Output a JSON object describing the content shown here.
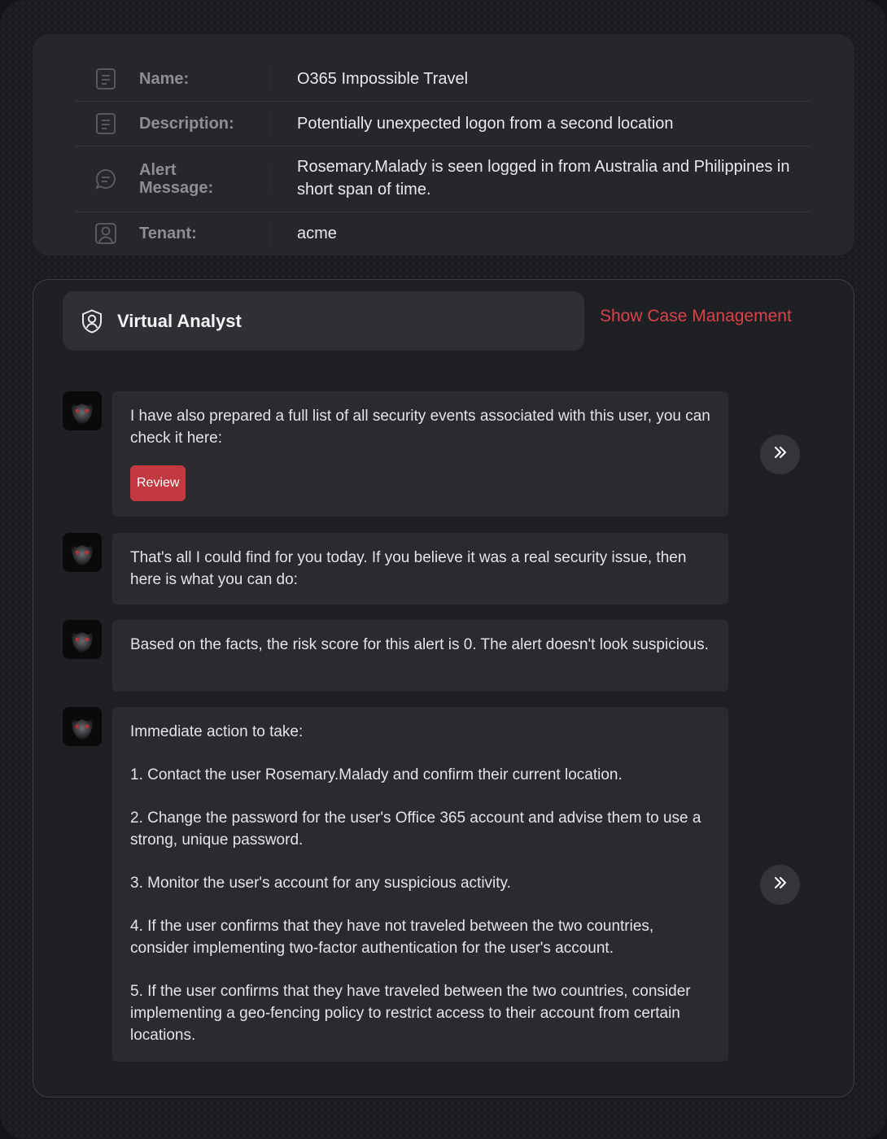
{
  "info": {
    "name_label": "Name:",
    "name_value": "O365 Impossible Travel",
    "description_label": "Description:",
    "description_value": "Potentially unexpected logon from a second location",
    "alert_label": "Alert Message:",
    "alert_value": "Rosemary.Malady is seen logged in from Australia and Philippines in short span of time.",
    "tenant_label": "Tenant:",
    "tenant_value": "acme",
    "icons": [
      "document-icon",
      "document-icon",
      "chat-icon",
      "user-icon"
    ]
  },
  "panel": {
    "title": "Virtual Analyst",
    "case_link": "Show Case Management",
    "accent_color": "#d7434b"
  },
  "messages": [
    {
      "text": "I have also prepared a full list of all security events associated with this user, you can check it here:",
      "button": "Review"
    },
    {
      "text": "That's all I could find for you today. If you believe it was a real security issue, then here is what you can do:"
    },
    {
      "text": "Based on the facts, the risk score for this alert is 0. The alert doesn't look suspicious."
    },
    {
      "intro": "Immediate action to take:",
      "steps": [
        "1. Contact the user Rosemary.Malady and confirm their current location.",
        "2. Change the password for the user's Office 365 account and advise them to use a strong, unique password.",
        "3. Monitor the user's account for any suspicious activity.",
        "4. If the user confirms that they have not traveled between the two countries, consider implementing two-factor authentication for the user's account.",
        "5. If the user confirms that they have traveled between the two countries, consider implementing a geo-fencing policy to restrict access to their account from certain locations."
      ]
    }
  ]
}
